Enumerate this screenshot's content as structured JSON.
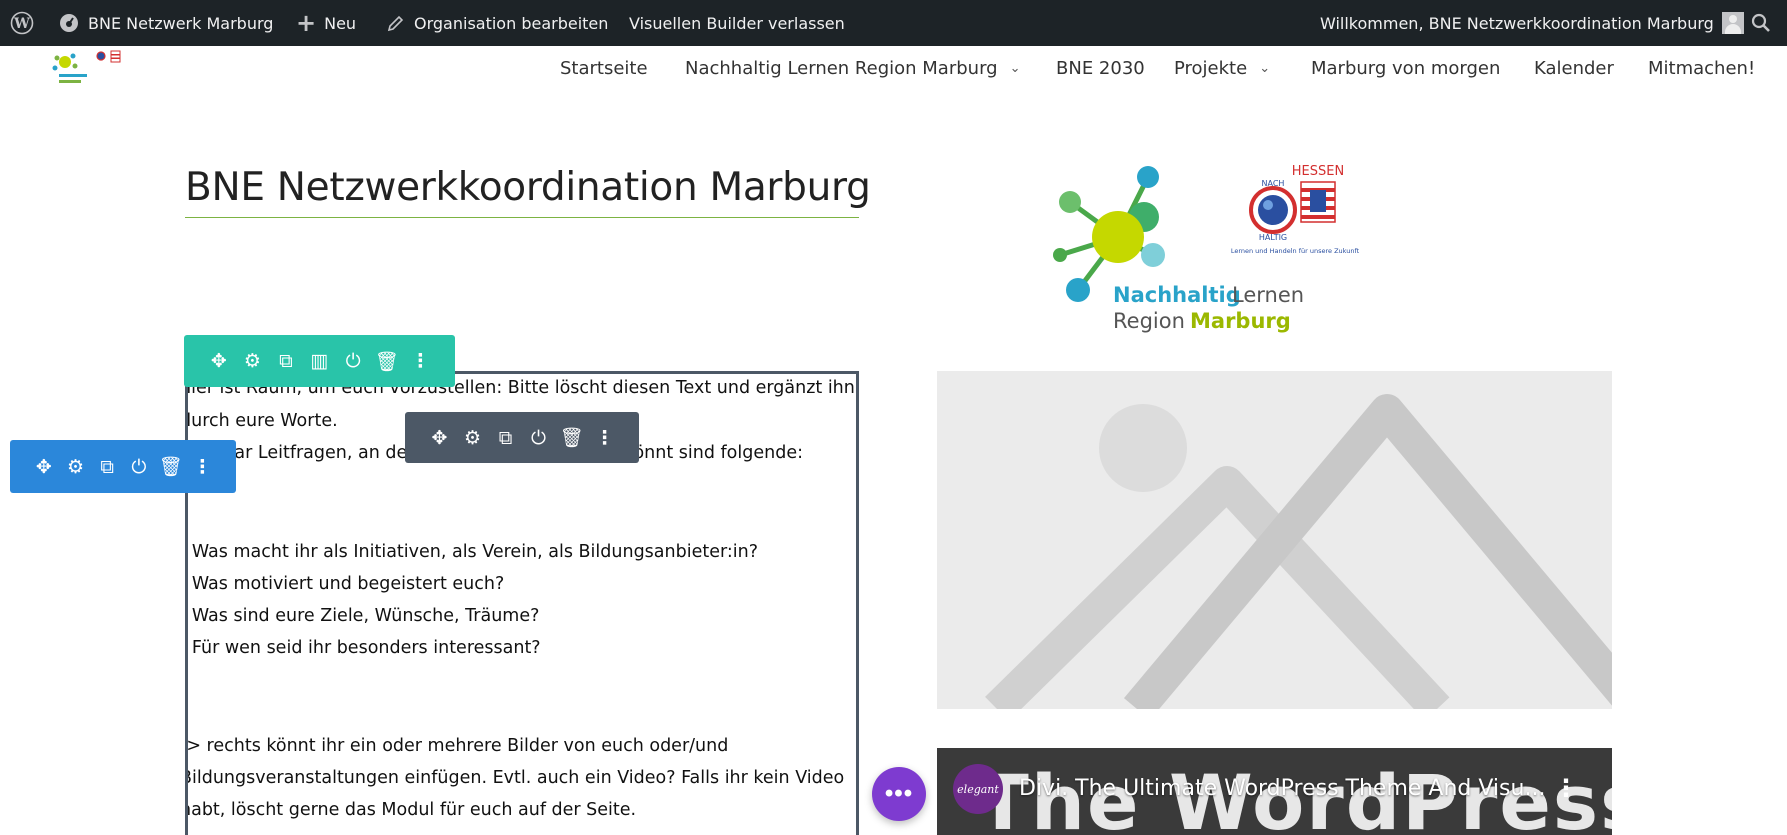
{
  "adminbar": {
    "site_name": "BNE Netzwerk Marburg",
    "new_label": "Neu",
    "edit_label": "Organisation bearbeiten",
    "exit_builder_label": "Visuellen Builder verlassen",
    "welcome": "Willkommen, BNE Netzwerkkoordination Marburg"
  },
  "nav": {
    "items": [
      {
        "label": "Startseite"
      },
      {
        "label": "Nachhaltig Lernen Region Marburg"
      },
      {
        "label": "BNE 2030"
      },
      {
        "label": "Projekte"
      },
      {
        "label": "Marburg von morgen"
      },
      {
        "label": "Kalender"
      },
      {
        "label": "Mitmachen!"
      }
    ]
  },
  "page": {
    "title": "BNE Netzwerkkoordination Marburg"
  },
  "text_module": {
    "lines": [
      "hier ist Raum, um euch vorzustellen: Bitte löscht diesen Text und ergänzt ihn",
      "durch eure Worte.",
      "Ein paar Leitfragen, an denen ihr euch orientieren könnt sind folgende:",
      "- Was macht ihr als Initiativen, als Verein, als Bildungsanbieter:in?",
      "- Was motiviert und begeistert euch?",
      "- Was sind eure Ziele, Wünsche, Träume?",
      "- Für wen seid ihr besonders interessant?",
      "-> rechts könnt ihr ein oder mehrere Bilder von euch oder/und",
      "Bildungsveranstaltungen einfügen. Evtl. auch ein Video? Falls ihr kein Video",
      "habt, löscht gerne das Modul für euch auf der Seite."
    ]
  },
  "logo": {
    "nachhaltig": "Nachhaltig",
    "lernen": "Lernen",
    "region": "Region",
    "marburg": "Marburg",
    "hessen": "HESSEN",
    "badge_top": "NACH",
    "badge_bottom": "HALTIG",
    "badge_caption": "Lernen und Handeln für unsere Zukunft"
  },
  "video": {
    "channel": "elegant",
    "title": "Divi. The Ultimate WordPress Theme And Visu...",
    "overlay_text": "The WordPress"
  },
  "colors": {
    "adminbar_bg": "#1d2327",
    "row_toolbar": "#29c4a9",
    "section_toolbar": "#2b87da",
    "module_toolbar": "#4c5866",
    "fab": "#7e3bd0",
    "accent_green": "#7cb342"
  }
}
